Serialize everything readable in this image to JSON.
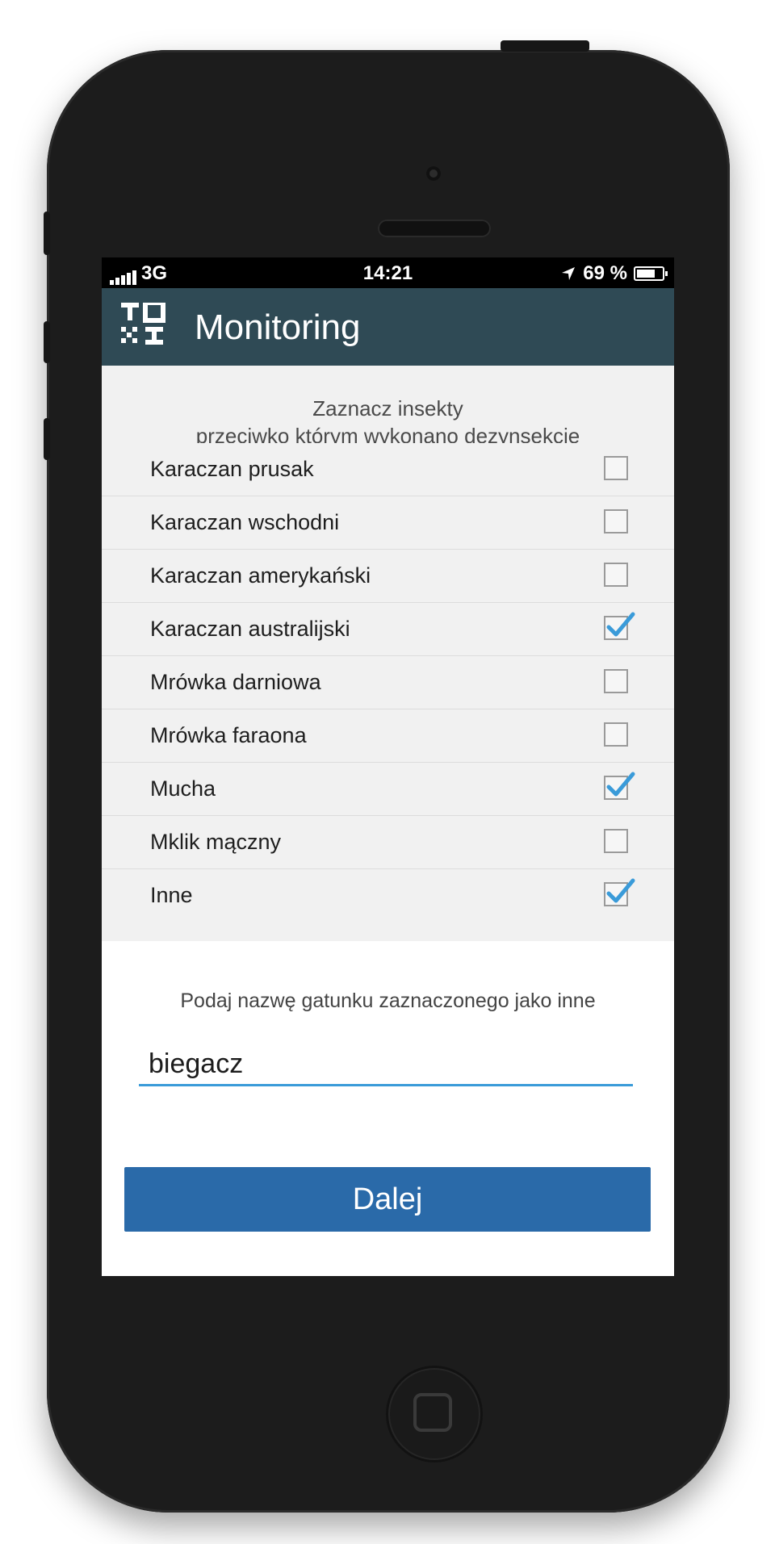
{
  "status_bar": {
    "network": "3G",
    "time": "14:21",
    "battery": "69 %"
  },
  "app_bar": {
    "logo": "toxi-logo",
    "title": "Monitoring"
  },
  "intro": {
    "line1": "Zaznacz insekty",
    "line2": "przeciwko którym wykonano dezynsekcję"
  },
  "insects": [
    {
      "label": "Karaczan prusak",
      "checked": false
    },
    {
      "label": "Karaczan wschodni",
      "checked": false
    },
    {
      "label": "Karaczan amerykański",
      "checked": false
    },
    {
      "label": "Karaczan australijski",
      "checked": true
    },
    {
      "label": "Mrówka darniowa",
      "checked": false
    },
    {
      "label": "Mrówka faraona",
      "checked": false
    },
    {
      "label": "Mucha",
      "checked": true
    },
    {
      "label": "Mklik mączny",
      "checked": false
    },
    {
      "label": "Inne",
      "checked": true
    }
  ],
  "other_species": {
    "prompt": "Podaj nazwę gatunku zaznaczonego jako inne",
    "value": "biegacz"
  },
  "next_button": {
    "label": "Dalej"
  },
  "colors": {
    "app_bar": "#2f4a55",
    "button": "#2a6aa9",
    "check": "#3a9bd9",
    "underline": "#3a9bd9"
  }
}
